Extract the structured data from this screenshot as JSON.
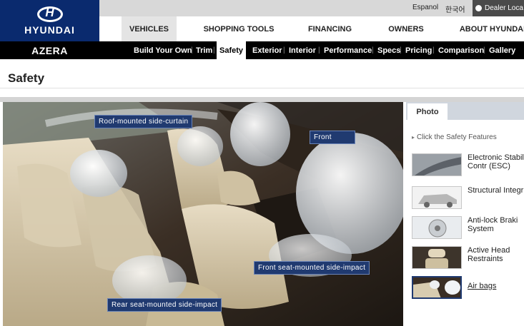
{
  "brand": {
    "name": "HYUNDAI"
  },
  "utility": {
    "links": [
      "Espanol",
      "한국어"
    ],
    "dealer_label": "Dealer Loca"
  },
  "primary_nav": [
    "VEHICLES",
    "SHOPPING TOOLS",
    "FINANCING",
    "OWNERS",
    "ABOUT HYUNDAI"
  ],
  "sub_nav": {
    "model": "AZERA",
    "items": [
      "Build Your Own",
      "Trim",
      "Safety",
      "Exterior",
      "Interior",
      "Performance",
      "Specs",
      "Pricing",
      "Comparison",
      "Gallery"
    ],
    "active": "Safety"
  },
  "page": {
    "title": "Safety"
  },
  "image_callouts": {
    "roof": "Roof-mounted side-curtain",
    "front": "Front",
    "front_side": "Front seat-mounted side-impact",
    "rear_side": "Rear seat-mounted side-impact"
  },
  "panel": {
    "tab": "Photo",
    "prompt": "Click the Safety Features",
    "features": [
      {
        "label": "Electronic Stability Contr (ESC)",
        "icon": "esc-road-thumb"
      },
      {
        "label": "Structural Integrity",
        "icon": "car-frame-thumb"
      },
      {
        "label": "Anti-lock Braki System",
        "icon": "brake-disc-thumb"
      },
      {
        "label": "Active Head Restraints",
        "icon": "head-restraint-thumb"
      },
      {
        "label": "Air bags",
        "icon": "airbag-thumb"
      }
    ]
  },
  "colors": {
    "brand_navy": "#0a2a6e",
    "callout_blue": "#203a70",
    "nav_active_bg": "#e4e4e4"
  }
}
